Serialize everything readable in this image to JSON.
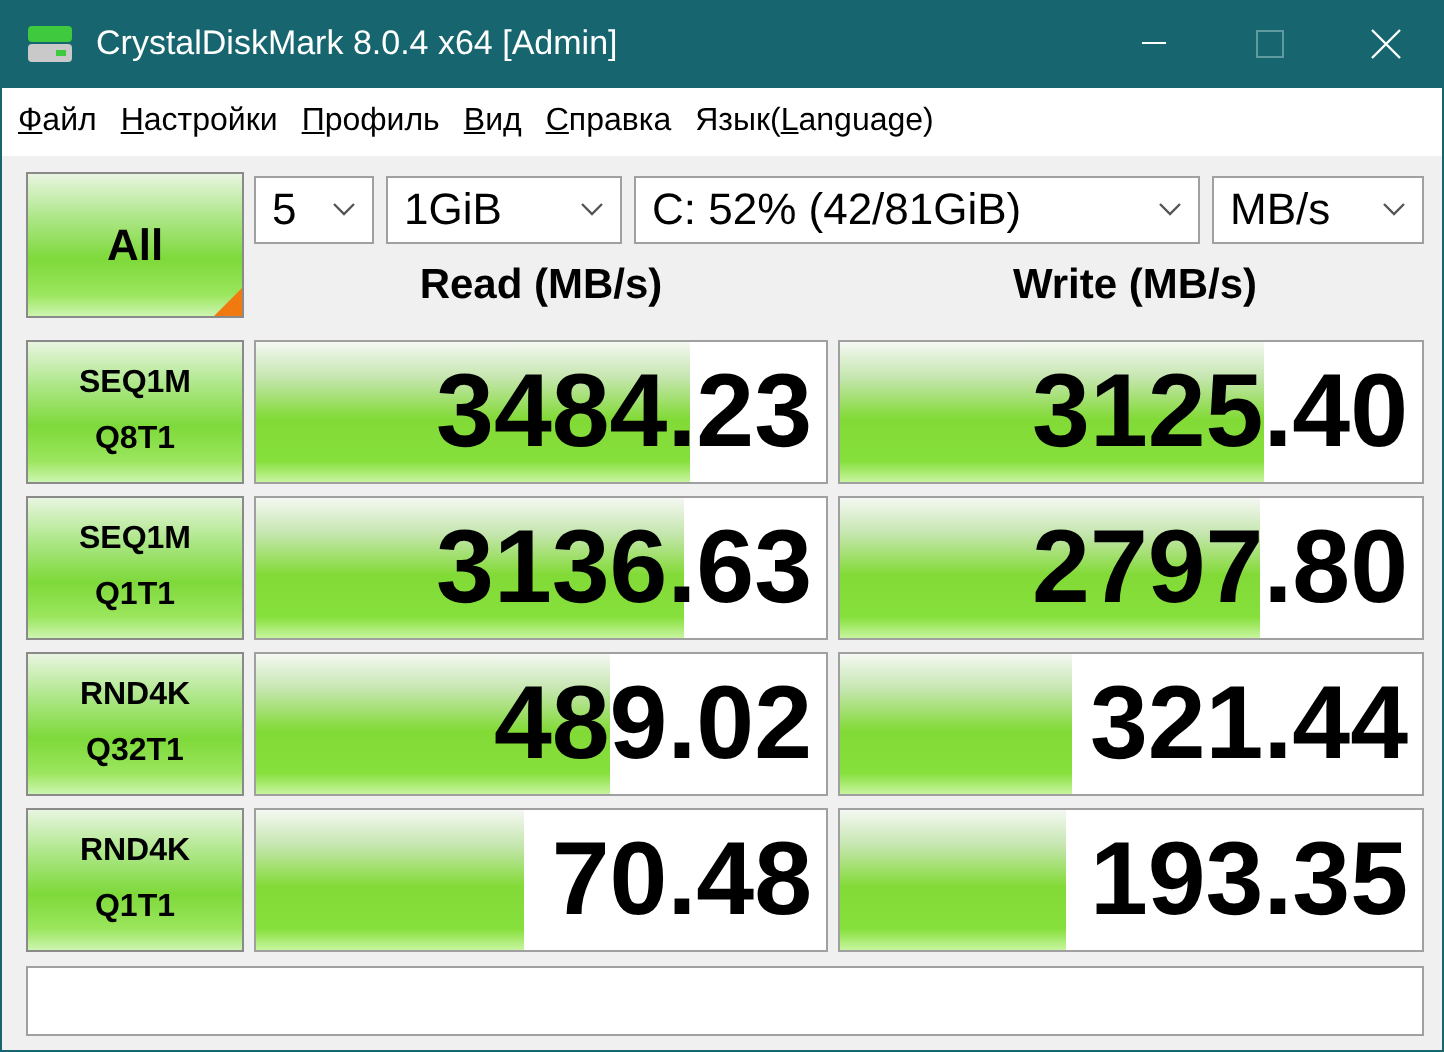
{
  "window": {
    "title": "CrystalDiskMark 8.0.4 x64 [Admin]"
  },
  "menu": [
    {
      "key": "Ф",
      "after": "айл"
    },
    {
      "key": "Н",
      "after": "астройки"
    },
    {
      "key": "П",
      "after": "рофиль"
    },
    {
      "key": "В",
      "after": "ид"
    },
    {
      "key": "С",
      "after": "правка"
    },
    {
      "before": "Язык(",
      "key": "L",
      "after": "anguage)"
    }
  ],
  "all_button": "All",
  "selectors": [
    {
      "kind": "count",
      "value": "5"
    },
    {
      "kind": "size",
      "value": "1GiB"
    },
    {
      "kind": "drive",
      "value": "C: 52% (42/81GiB)"
    },
    {
      "kind": "unit",
      "value": "MB/s"
    }
  ],
  "columns": [
    "Read (MB/s)",
    "Write (MB/s)"
  ],
  "rows": [
    {
      "test": [
        "SEQ1M",
        "Q8T1"
      ],
      "read": {
        "value": "3484.23",
        "level": 0.76
      },
      "write": {
        "value": "3125.40",
        "level": 0.73
      }
    },
    {
      "test": [
        "SEQ1M",
        "Q1T1"
      ],
      "read": {
        "value": "3136.63",
        "level": 0.75
      },
      "write": {
        "value": "2797.80",
        "level": 0.72
      }
    },
    {
      "test": [
        "RND4K",
        "Q32T1"
      ],
      "read": {
        "value": "489.02",
        "level": 0.62
      },
      "write": {
        "value": "321.44",
        "level": 0.4
      }
    },
    {
      "test": [
        "RND4K",
        "Q1T1"
      ],
      "read": {
        "value": "70.48",
        "level": 0.47
      },
      "write": {
        "value": "193.35",
        "level": 0.39
      }
    }
  ]
}
